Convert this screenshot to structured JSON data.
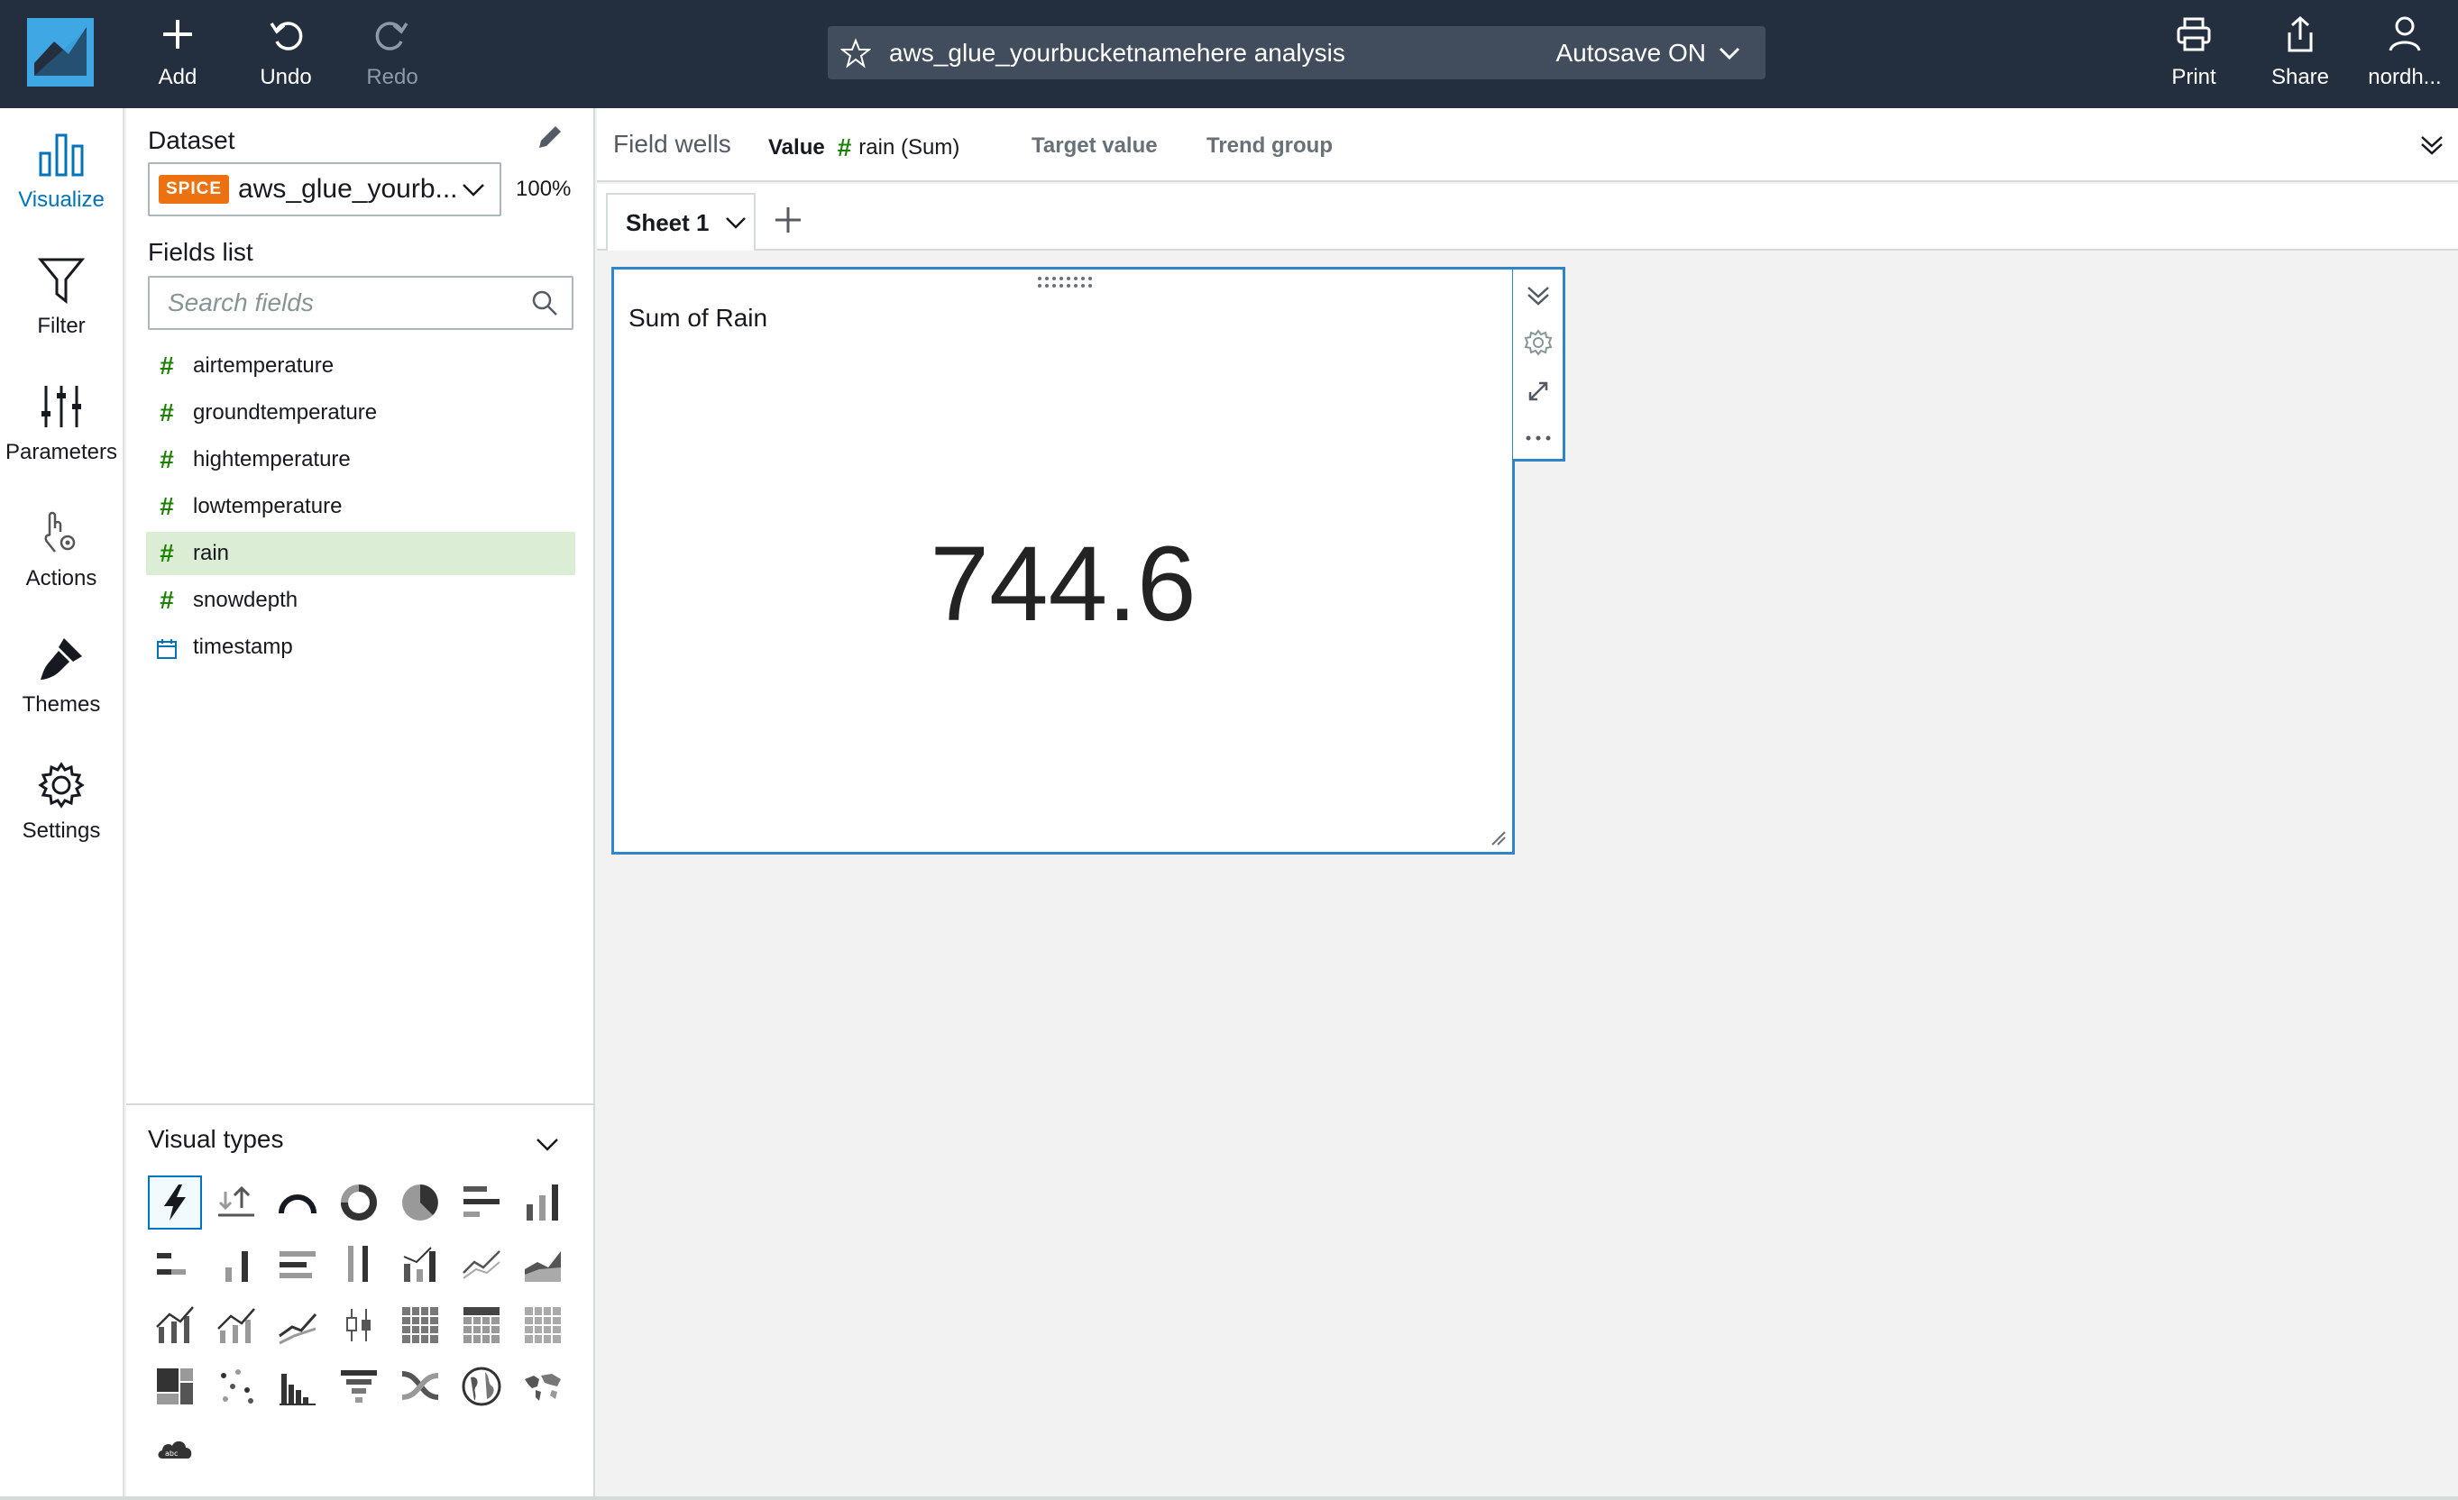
{
  "topbar": {
    "add_label": "Add",
    "undo_label": "Undo",
    "redo_label": "Redo",
    "analysis_title": "aws_glue_yourbucketnamehere analysis",
    "autosave_label": "Autosave ON",
    "print_label": "Print",
    "share_label": "Share",
    "user_label": "nordh..."
  },
  "rail": {
    "items": [
      {
        "label": "Visualize",
        "icon": "bar-chart-icon",
        "active": true
      },
      {
        "label": "Filter",
        "icon": "funnel-icon"
      },
      {
        "label": "Parameters",
        "icon": "sliders-icon"
      },
      {
        "label": "Actions",
        "icon": "pointer-gear-icon"
      },
      {
        "label": "Themes",
        "icon": "paintbrush-icon"
      },
      {
        "label": "Settings",
        "icon": "gear-icon"
      }
    ]
  },
  "datapanel": {
    "dataset_heading": "Dataset",
    "spice_badge": "SPICE",
    "dataset_name": "aws_glue_yourb...",
    "spice_percent": "100%",
    "fields_heading": "Fields list",
    "search_placeholder": "Search fields",
    "fields": [
      {
        "name": "airtemperature",
        "type": "numeric"
      },
      {
        "name": "groundtemperature",
        "type": "numeric"
      },
      {
        "name": "hightemperature",
        "type": "numeric"
      },
      {
        "name": "lowtemperature",
        "type": "numeric"
      },
      {
        "name": "rain",
        "type": "numeric",
        "selected": true
      },
      {
        "name": "snowdepth",
        "type": "numeric"
      },
      {
        "name": "timestamp",
        "type": "date"
      }
    ],
    "visual_types_heading": "Visual types"
  },
  "field_wells": {
    "title": "Field wells",
    "value_label": "Value",
    "value_field": "rain (Sum)",
    "target_label": "Target value",
    "trend_label": "Trend group"
  },
  "sheets": {
    "tabs": [
      {
        "label": "Sheet 1"
      }
    ]
  },
  "visual": {
    "title": "Sum of Rain",
    "kpi_value": "744.6"
  },
  "colors": {
    "topbar_bg": "#232f3e",
    "accent_blue": "#0073bb",
    "spice_orange": "#ec7211",
    "numeric_green": "#1d8102",
    "selected_field_bg": "#dcedd6"
  }
}
